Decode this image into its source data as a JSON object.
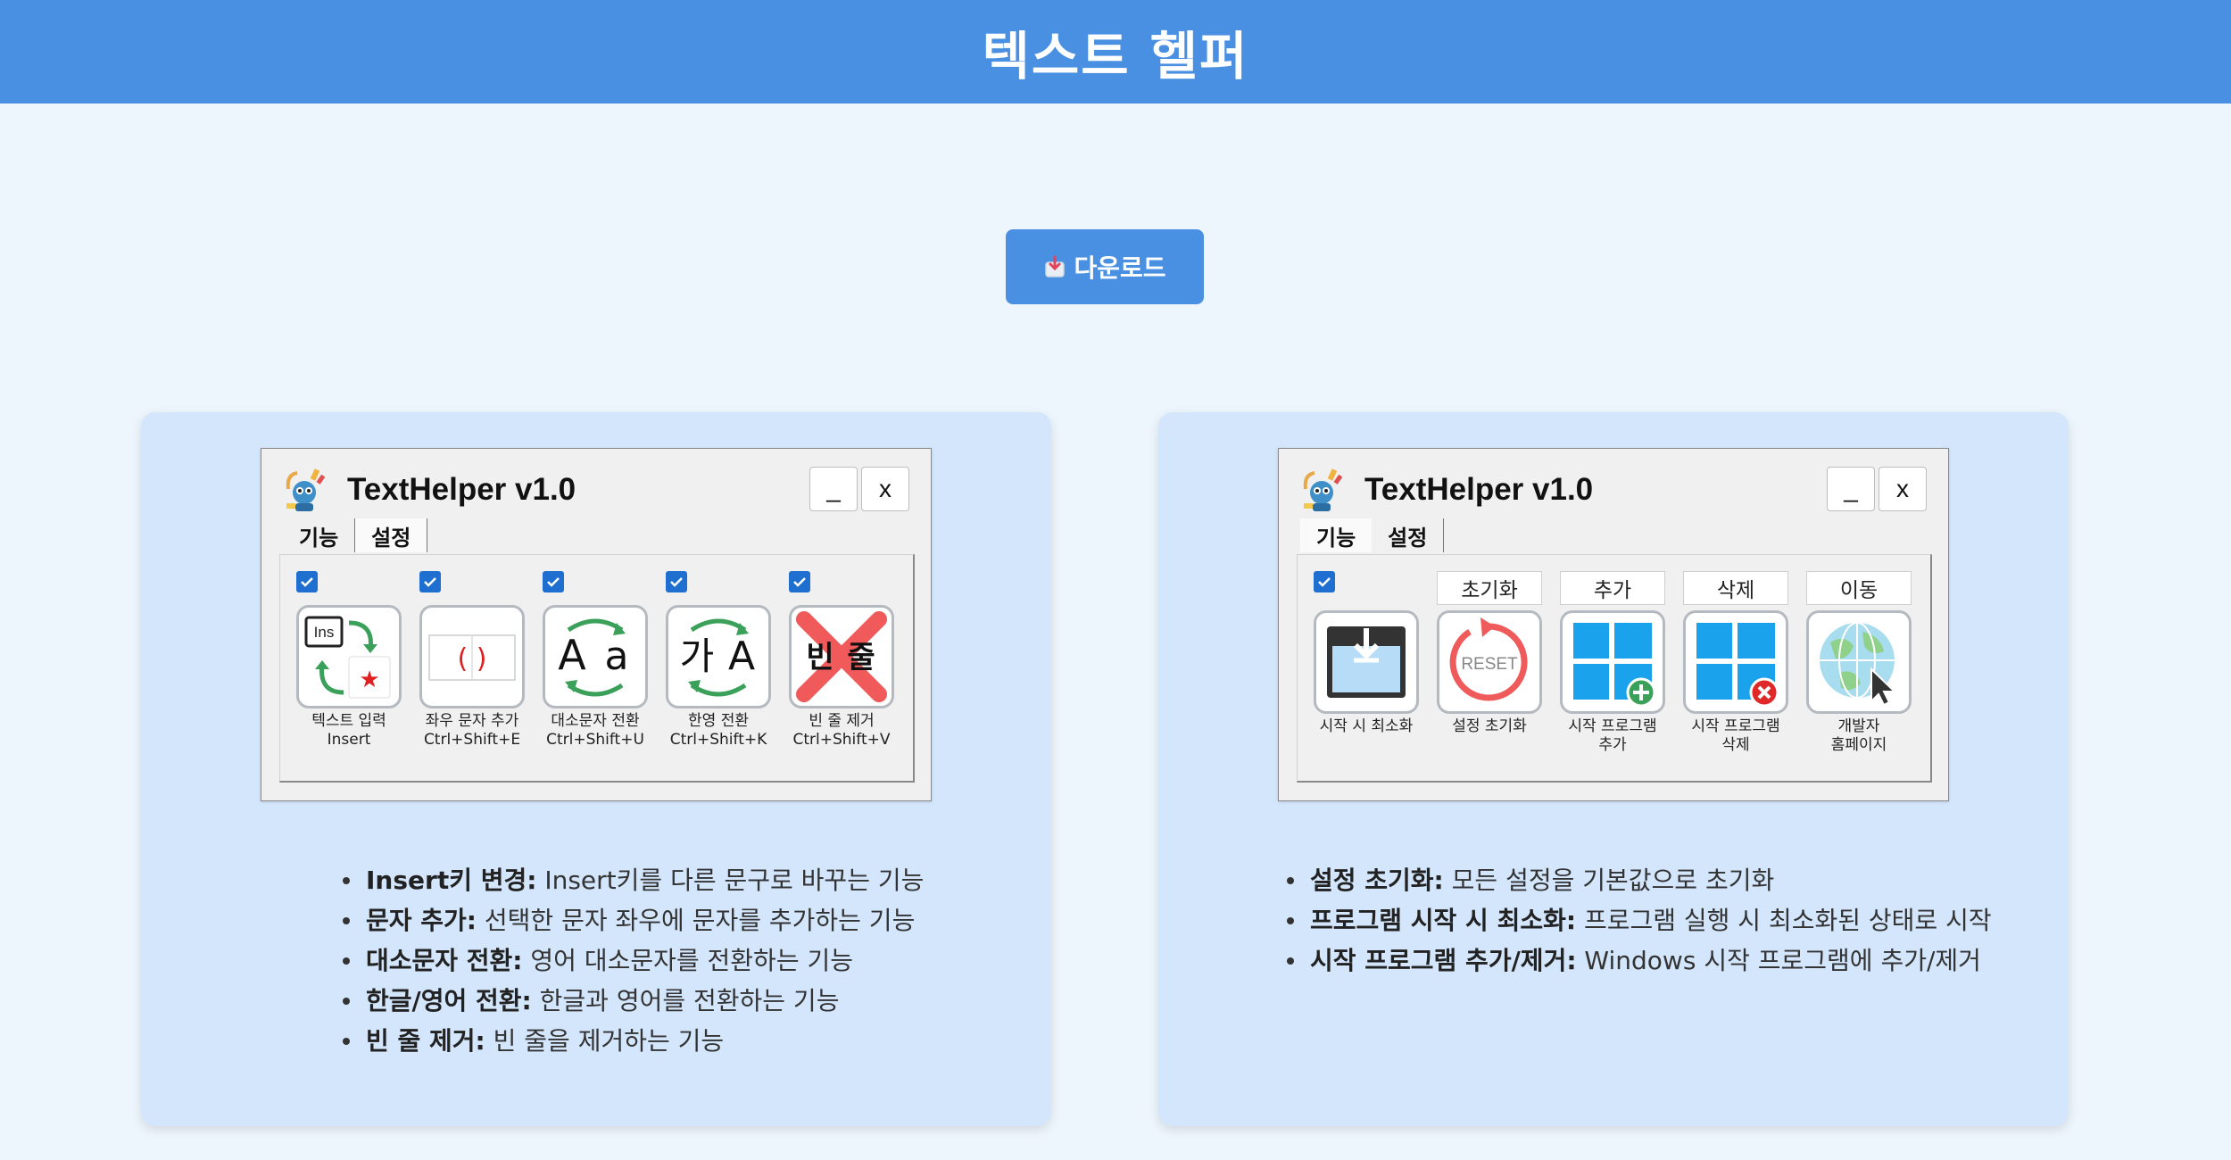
{
  "header": {
    "title": "텍스트 헬퍼"
  },
  "download": {
    "label": "다운로드"
  },
  "left_card": {
    "window": {
      "title": "TextHelper v1.0",
      "min_label": "_",
      "close_label": "x",
      "tabs": [
        "기능",
        "설정"
      ],
      "active_tab": "기능"
    },
    "items": [
      {
        "line1": "텍스트 입력",
        "line2": "Insert",
        "checked": true,
        "icon": "insert-icon"
      },
      {
        "line1": "좌우 문자 추가",
        "line2": "Ctrl+Shift+E",
        "checked": true,
        "icon": "brackets-icon"
      },
      {
        "line1": "대소문자 전환",
        "line2": "Ctrl+Shift+U",
        "checked": true,
        "icon": "case-toggle-icon"
      },
      {
        "line1": "한영 전환",
        "line2": "Ctrl+Shift+K",
        "checked": true,
        "icon": "lang-toggle-icon"
      },
      {
        "line1": "빈 줄 제거",
        "line2": "Ctrl+Shift+V",
        "checked": true,
        "icon": "blank-line-remove-icon"
      }
    ],
    "bullets": [
      {
        "bold": "Insert키 변경:",
        "text": " Insert키를 다른 문구로 바꾸는 기능"
      },
      {
        "bold": "문자 추가:",
        "text": " 선택한 문자 좌우에 문자를 추가하는 기능"
      },
      {
        "bold": "대소문자 전환:",
        "text": " 영어 대소문자를 전환하는 기능"
      },
      {
        "bold": "한글/영어 전환:",
        "text": " 한글과 영어를 전환하는 기능"
      },
      {
        "bold": "빈 줄 제거:",
        "text": " 빈 줄을 제거하는 기능"
      }
    ],
    "icon_text": {
      "ins": "Ins",
      "paren": "( )",
      "case_big": "A",
      "case_small": "a",
      "ga": "가",
      "A": "A",
      "bin": "빈",
      "jul": "줄"
    }
  },
  "right_card": {
    "window": {
      "title": "TextHelper v1.0",
      "min_label": "_",
      "close_label": "x",
      "tabs": [
        "기능",
        "설정"
      ],
      "active_tab": "설정"
    },
    "checkbox_checked": true,
    "items": [
      {
        "button": "",
        "line1": "시작 시 최소화",
        "line2": "",
        "icon": "minimize-start-icon"
      },
      {
        "button": "초기화",
        "line1": "설정 초기화",
        "line2": "",
        "icon": "reset-icon"
      },
      {
        "button": "추가",
        "line1": "시작 프로그램",
        "line2": "추가",
        "icon": "windows-add-icon"
      },
      {
        "button": "삭제",
        "line1": "시작 프로그램",
        "line2": "삭제",
        "icon": "windows-remove-icon"
      },
      {
        "button": "이동",
        "line1": "개발자",
        "line2": "홈페이지",
        "icon": "globe-cursor-icon"
      }
    ],
    "reset_text": "RESET",
    "bullets": [
      {
        "bold": "설정 초기화:",
        "text": " 모든 설정을 기본값으로 초기화"
      },
      {
        "bold": "프로그램 시작 시 최소화:",
        "text": " 프로그램 실행 시 최소화된 상태로 시작"
      },
      {
        "bold": "시작 프로그램 추가/제거:",
        "text": " Windows 시작 프로그램에 추가/제거"
      }
    ]
  },
  "colors": {
    "header": "#4a90e2",
    "card": "#d3e6fc",
    "page": "#eef6fd",
    "checkbox": "#1f6fd1"
  }
}
